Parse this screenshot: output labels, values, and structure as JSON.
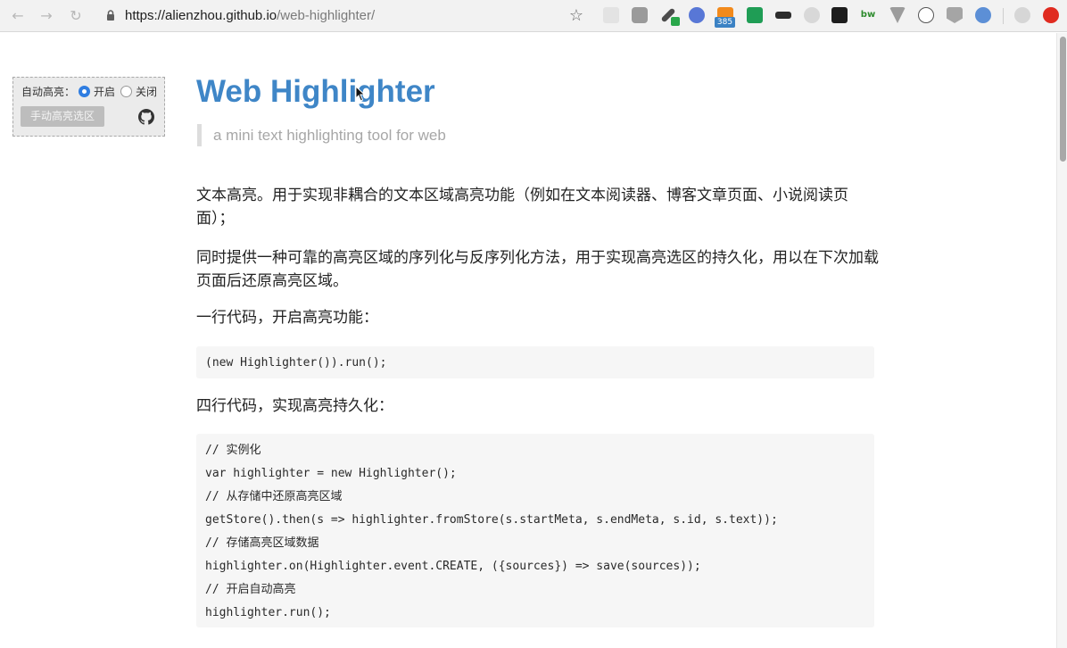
{
  "browser": {
    "back_glyph": "←",
    "forward_glyph": "→",
    "reload_glyph": "↻",
    "url_host": "https://alienzhou.github.io",
    "url_path": "/web-highlighter/",
    "bookmark_glyph": "☆",
    "extension_badge": "385"
  },
  "panel": {
    "label": "自动高亮：",
    "option_on": "开启",
    "option_off": "关闭",
    "selected": "开启",
    "manual_button": "手动高亮选区"
  },
  "page": {
    "title": "Web Highlighter",
    "subtitle": "a mini text highlighting tool for web",
    "paragraph1": "文本高亮。用于实现非耦合的文本区域高亮功能（例如在文本阅读器、博客文章页面、小说阅读页面）；",
    "paragraph2": "同时提供一种可靠的高亮区域的序列化与反序列化方法，用于实现高亮选区的持久化，用以在下次加载页面后还原高亮区域。",
    "heading1": "一行代码，开启高亮功能：",
    "code1": [
      "(new Highlighter()).run();"
    ],
    "heading2": "四行代码，实现高亮持久化：",
    "code2": [
      "// 实例化",
      "var highlighter = new Highlighter();",
      "// 从存储中还原高亮区域",
      "getStore().then(s => highlighter.fromStore(s.startMeta, s.endMeta, s.id, s.text));",
      "// 存储高亮区域数据",
      "highlighter.on(Highlighter.event.CREATE, ({sources}) => save(sources));",
      "// 开启自动高亮",
      "highlighter.run();"
    ]
  },
  "colors": {
    "title": "#3f86c7",
    "radio_selected": "#2f7de1",
    "manual_button_bg": "#bdbdbd",
    "code_bg": "#f6f6f6"
  },
  "icons": [
    "back-icon",
    "forward-icon",
    "reload-icon",
    "lock-icon",
    "bookmark-star-icon",
    "github-icon",
    "cursor-icon"
  ]
}
